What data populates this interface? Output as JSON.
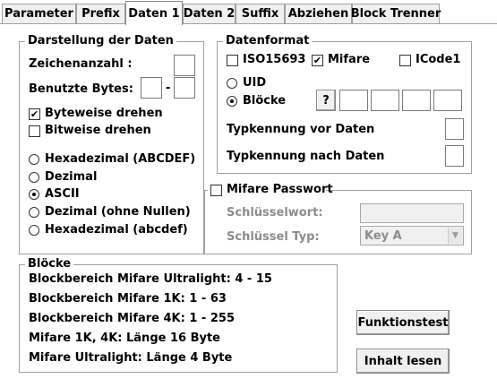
{
  "tabs": [
    {
      "label": "Parameter"
    },
    {
      "label": "Prefix"
    },
    {
      "label": "Daten 1"
    },
    {
      "label": "Daten 2"
    },
    {
      "label": "Suffix"
    },
    {
      "label": "Abziehen"
    },
    {
      "label": "Block Trenner"
    }
  ],
  "active_tab": "Daten 1",
  "darstellung": {
    "title": "Darstellung der Daten",
    "zeichenanzahl_label": "Zeichenanzahl :",
    "zeichenanzahl_value": "",
    "bytes_label": "Benutzte Bytes:",
    "bytes_from": "",
    "bytes_dash": "-",
    "bytes_to": "",
    "byteweise": {
      "label": "Byteweise drehen",
      "checked": true,
      "mark": "✔"
    },
    "bitweise": {
      "label": "Bitweise drehen",
      "checked": false
    },
    "formats": [
      {
        "label": "Hexadezimal (ABCDEF)",
        "selected": false
      },
      {
        "label": "Dezimal",
        "selected": false
      },
      {
        "label": "ASCII",
        "selected": true
      },
      {
        "label": "Dezimal (ohne Nullen)",
        "selected": false
      },
      {
        "label": "Hexadezimal (abcdef)",
        "selected": false
      }
    ]
  },
  "datenformat": {
    "title": "Datenformat",
    "iso": {
      "label": "ISO15693",
      "checked": false
    },
    "mifare": {
      "label": "Mifare",
      "checked": true,
      "mark": "✔"
    },
    "icode": {
      "label": "ICode1",
      "checked": false
    },
    "uid": {
      "label": "UID",
      "selected": false
    },
    "bloecke": {
      "label": "Blöcke",
      "selected": true
    },
    "help_label": "?",
    "block_values": [
      "",
      "",
      "",
      ""
    ],
    "typ_vor_label": "Typkennung vor Daten",
    "typ_vor_value": "",
    "typ_nach_label": "Typkennung nach Daten",
    "typ_nach_value": ""
  },
  "passwort": {
    "title": "Mifare Passwort",
    "checked": false,
    "schluesselwort_label": "Schlüsselwort:",
    "schluesselwort_value": "",
    "typ_label": "Schlüssel Typ:",
    "typ_value": "Key A"
  },
  "bloecke_info": {
    "title": "Blöcke",
    "lines": [
      "Blockbereich Mifare Ultralight: 4 - 15",
      "Blockbereich Mifare 1K: 1 - 63",
      "Blockbereich Mifare 4K: 1 - 255",
      "Mifare 1K, 4K: Länge 16 Byte",
      "Mifare Ultralight: Länge 4 Byte"
    ]
  },
  "buttons": {
    "funktionstest": "Funktionstest",
    "inhalt_lesen": "Inhalt lesen"
  }
}
